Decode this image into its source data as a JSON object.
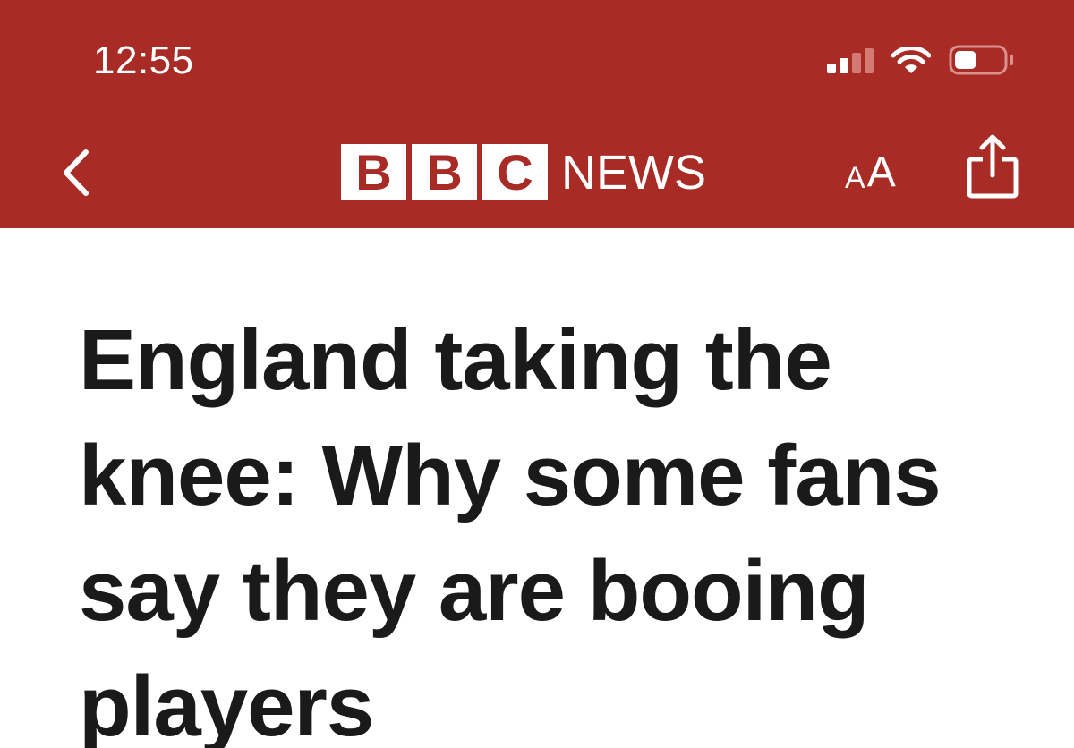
{
  "status_bar": {
    "time": "12:55",
    "signal_icon": "cellular-signal-icon",
    "wifi_icon": "wifi-icon",
    "battery_icon": "battery-icon",
    "battery_level": 0.45
  },
  "header": {
    "background_color": "#a82b25",
    "back_icon": "chevron-left-icon",
    "logo": {
      "letters": [
        "B",
        "B",
        "C"
      ],
      "wordmark": "NEWS"
    },
    "text_size": {
      "small": "A",
      "large": "A"
    },
    "share_icon": "share-icon"
  },
  "article": {
    "headline": "England taking the knee: Why some fans say they are booing players"
  }
}
